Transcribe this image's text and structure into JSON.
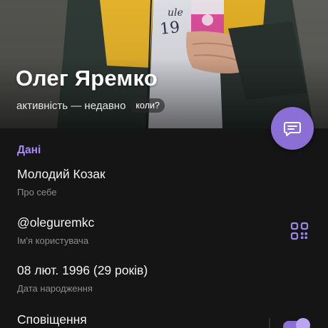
{
  "profile": {
    "name": "Олег Яремко",
    "status": "активність — недавно",
    "when_chip": "коли?"
  },
  "section": {
    "title": "Дані"
  },
  "info": {
    "bio_value": "Молодий Козак",
    "bio_label": "Про себе",
    "username_value": "@oleguremkc",
    "username_label": "Ім'я користувача",
    "birthday_value": "08 лют. 1996 (29 років)",
    "birthday_label": "Дата народження",
    "notifications_label": "Сповіщення"
  },
  "icons": {
    "fab": "message-icon",
    "qr": "qr-code-icon",
    "toggle": "notifications-toggle"
  },
  "colors": {
    "accent": "#8b6fd4",
    "accent_text": "#a68cf0",
    "background": "#151515",
    "secondary_text": "#8c8c8c"
  }
}
